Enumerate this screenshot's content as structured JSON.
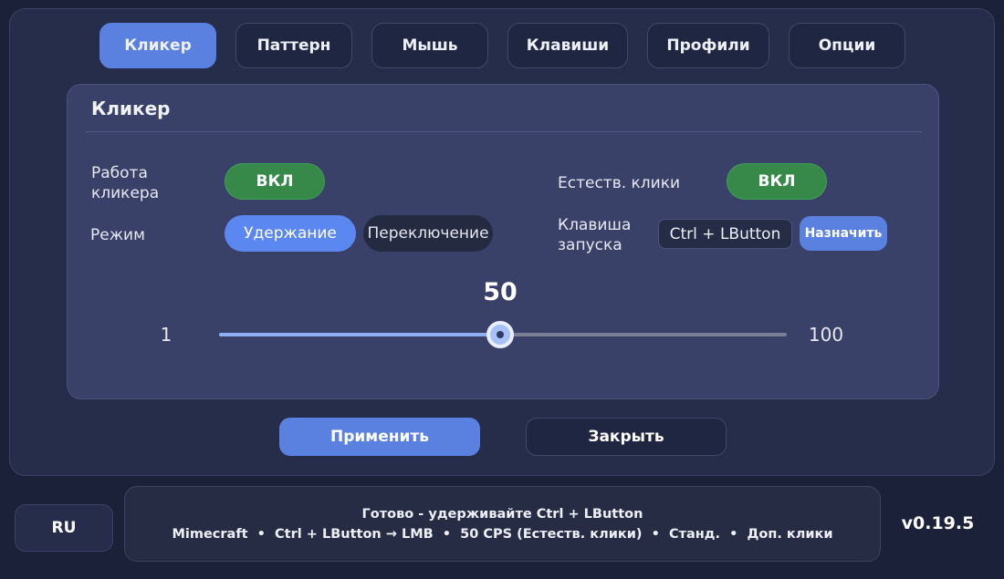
{
  "tabs": [
    {
      "label": "Кликер",
      "active": true
    },
    {
      "label": "Паттерн",
      "active": false
    },
    {
      "label": "Мышь",
      "active": false
    },
    {
      "label": "Клавиши",
      "active": false
    },
    {
      "label": "Профили",
      "active": false
    },
    {
      "label": "Опции",
      "active": false
    }
  ],
  "panel": {
    "title": "Кликер",
    "clicker_work": {
      "label": "Работа кликера",
      "value": "ВКЛ"
    },
    "natural_clicks": {
      "label": "Естеств. клики",
      "value": "ВКЛ"
    },
    "mode": {
      "label": "Режим",
      "options": [
        "Удержание",
        "Переключение"
      ],
      "selected": "Удержание"
    },
    "hotkey": {
      "label": "Клавиша запуска",
      "value": "Ctrl + LButton",
      "assign_label": "Назначить"
    },
    "slider": {
      "value": 50,
      "min": 1,
      "max": 100,
      "value_text": "50",
      "min_text": "1",
      "max_text": "100"
    }
  },
  "buttons": {
    "apply": "Применить",
    "close": "Закрыть"
  },
  "footer": {
    "language": "RU",
    "status_line1": "Готово - удерживайте Ctrl + LButton",
    "status_line2": "Mimecraft  •  Ctrl + LButton → LMB  •  50 CPS (Естеств. клики)  •  Станд.  •  Доп. клики",
    "version": "v0.19.5"
  },
  "colors": {
    "accent": "#5a80e0",
    "on_green": "#37894a",
    "background": "#1b2138"
  }
}
